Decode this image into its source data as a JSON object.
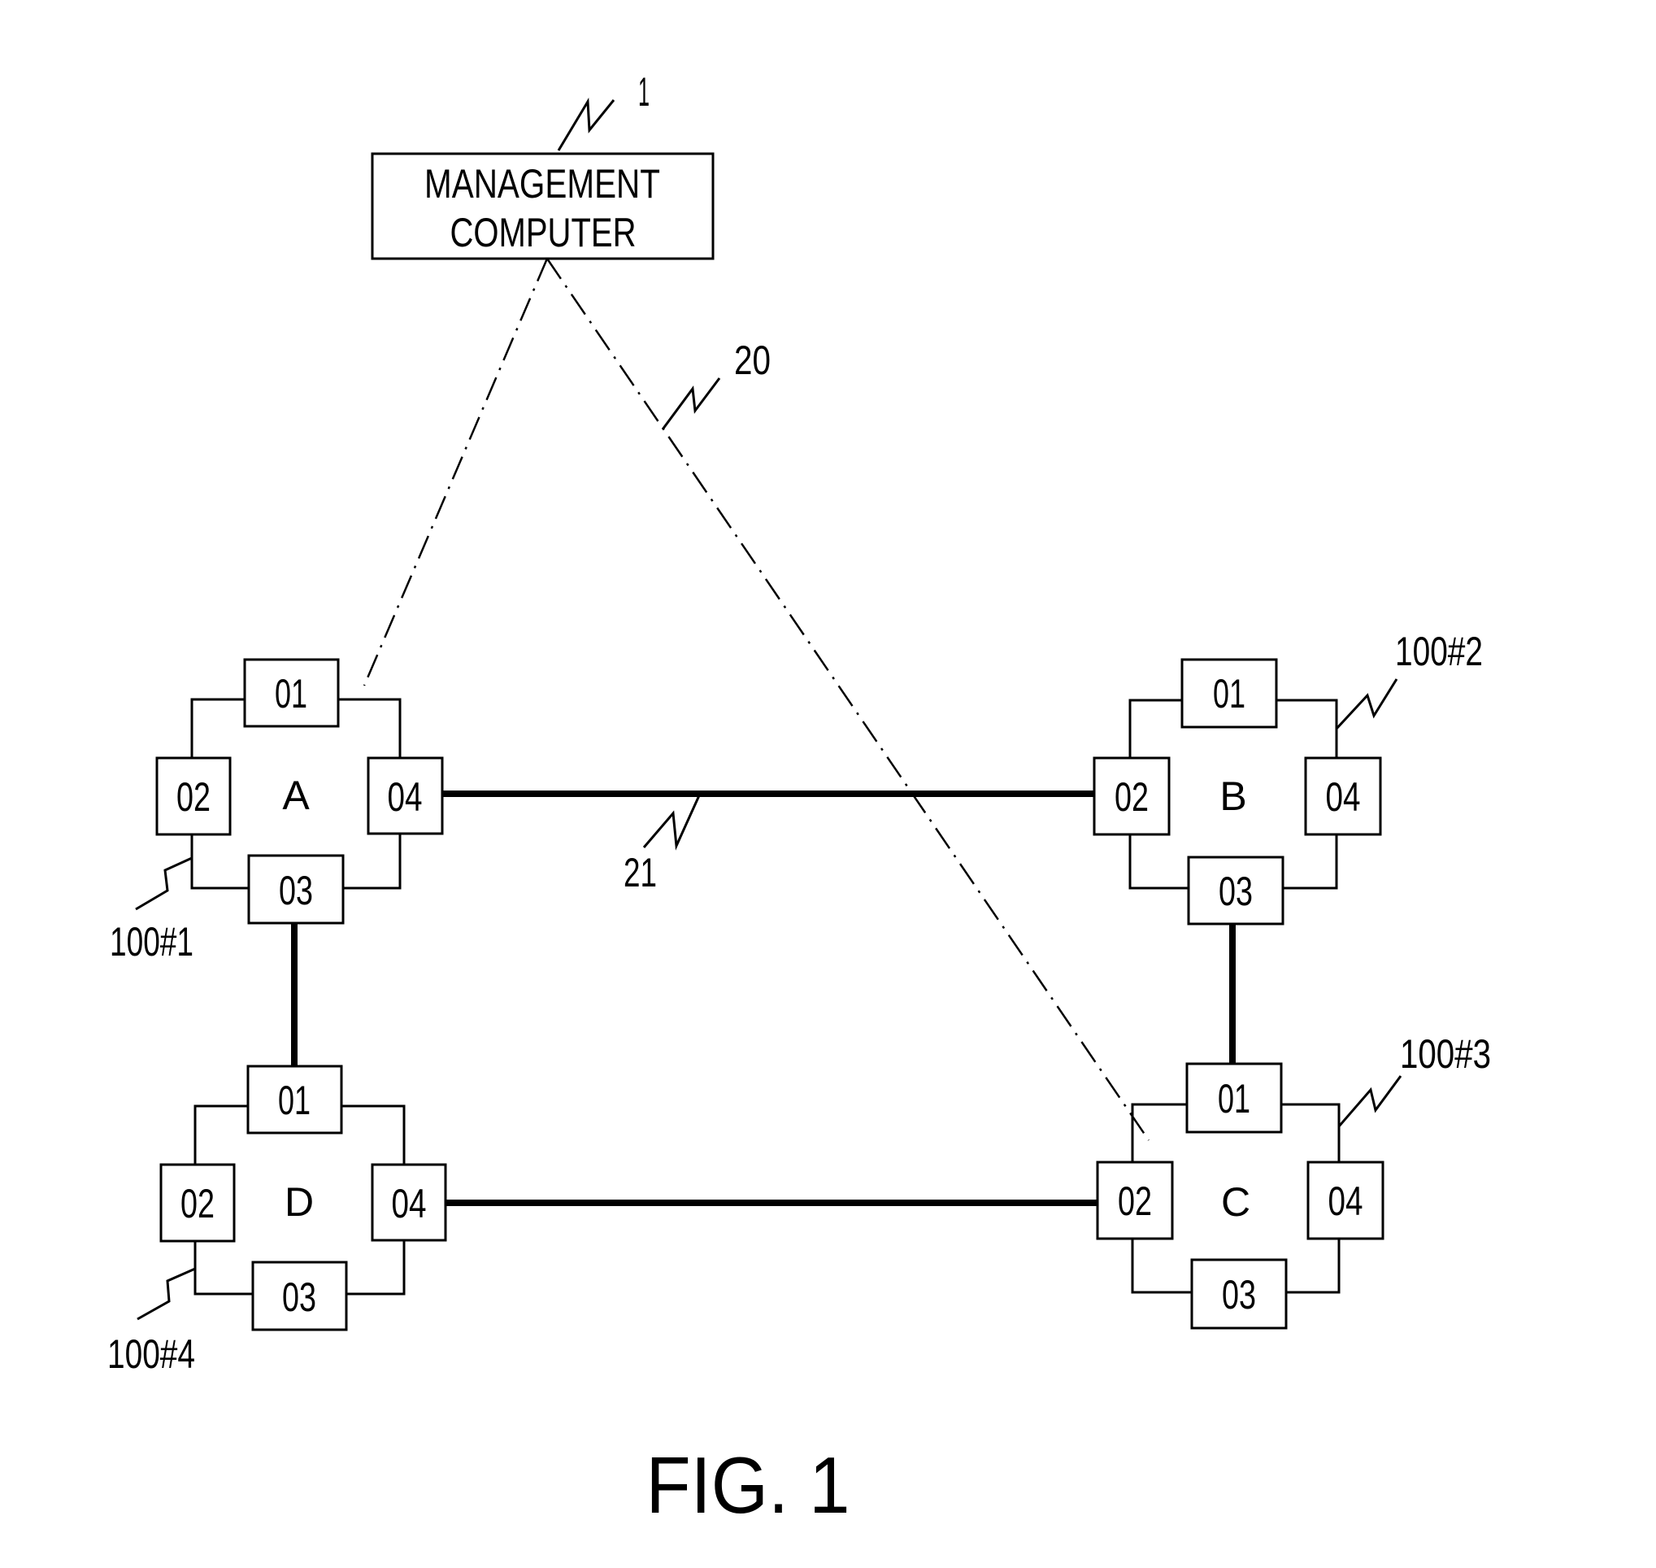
{
  "figure": {
    "caption": "FIG. 1"
  },
  "management_computer": {
    "line1": "MANAGEMENT",
    "line2": "COMPUTER",
    "ref": "1"
  },
  "management_network": {
    "ref": "20",
    "style": "dash-dot",
    "connects": [
      "management_computer",
      "node A",
      "node C"
    ]
  },
  "data_link": {
    "ref": "21",
    "style": "solid-thick"
  },
  "nodes": [
    {
      "id": "A",
      "label": "A",
      "ref": "100#1",
      "ports": [
        "01",
        "02",
        "03",
        "04"
      ]
    },
    {
      "id": "B",
      "label": "B",
      "ref": "100#2",
      "ports": [
        "01",
        "02",
        "03",
        "04"
      ]
    },
    {
      "id": "C",
      "label": "C",
      "ref": "100#3",
      "ports": [
        "01",
        "02",
        "03",
        "04"
      ]
    },
    {
      "id": "D",
      "label": "D",
      "ref": "100#4",
      "ports": [
        "01",
        "02",
        "03",
        "04"
      ]
    }
  ],
  "links": [
    {
      "from": "A.04",
      "to": "B.02"
    },
    {
      "from": "A.03",
      "to": "D.01"
    },
    {
      "from": "B.03",
      "to": "C.01"
    },
    {
      "from": "D.04",
      "to": "C.02"
    }
  ]
}
